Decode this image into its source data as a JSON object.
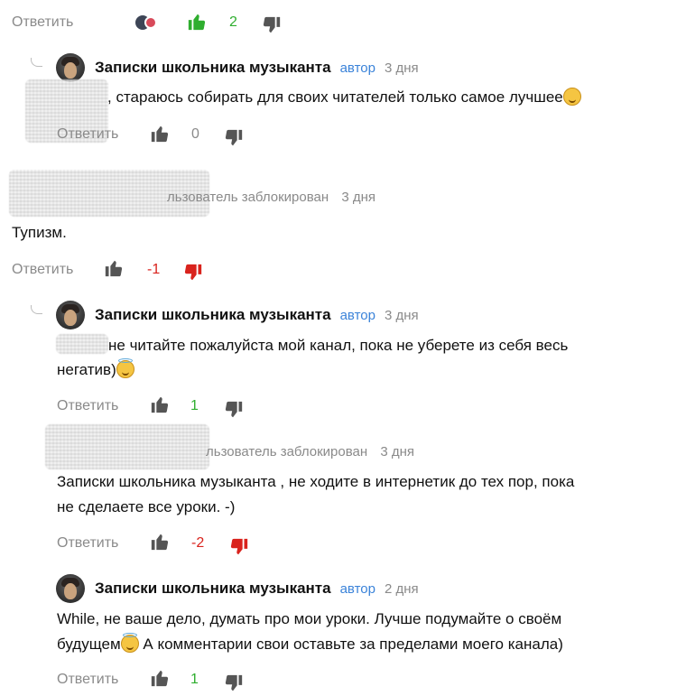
{
  "colors": {
    "positive": "#2fae2f",
    "negative": "#d9231d",
    "muted": "#8a8a8a",
    "author_badge": "#3b83d9"
  },
  "top_actions": {
    "reply_label": "Ответить",
    "count": "2"
  },
  "comments": [
    {
      "author": "Записки школьника музыканта",
      "badge": "автор",
      "age": "3 дня",
      "text": ", стараюсь собирать для своих читателей только самое лучшее",
      "reply_label": "Ответить",
      "count": "0"
    },
    {
      "meta": "льзователь заблокирован",
      "age": "3 дня",
      "text": "Тупизм.",
      "reply_label": "Ответить",
      "count": "-1"
    },
    {
      "author": "Записки школьника музыканта",
      "badge": "автор",
      "age": "3 дня",
      "text_line1": " не читайте пожалуйста мой канал, пока не уберете из себя весь",
      "text_line2": "негатив)",
      "reply_label": "Ответить",
      "count": "1"
    },
    {
      "meta": "льзователь заблокирован",
      "age": "3 дня",
      "text_line1": "Записки школьника музыканта , не ходите в интернетик до тех пор, пока",
      "text_line2": "не сделаете все уроки. -)",
      "reply_label": "Ответить",
      "count": "-2"
    },
    {
      "author": "Записки школьника музыканта",
      "badge": "автор",
      "age": "2 дня",
      "text_line1": "While, не ваше дело, думать про мои уроки. Лучше подумайте о своём",
      "text_line2a": "будущем",
      "text_line2b": " А комментарии свои оставьте за пределами моего канала)",
      "reply_label": "Ответить",
      "count": "1"
    }
  ],
  "icons": {
    "like": "thumbs-up-icon",
    "dislike": "thumbs-down-icon",
    "avatar": "avatar",
    "emoji_grin": "grinning-emoji-icon",
    "emoji_halo": "halo-emoji-icon"
  }
}
